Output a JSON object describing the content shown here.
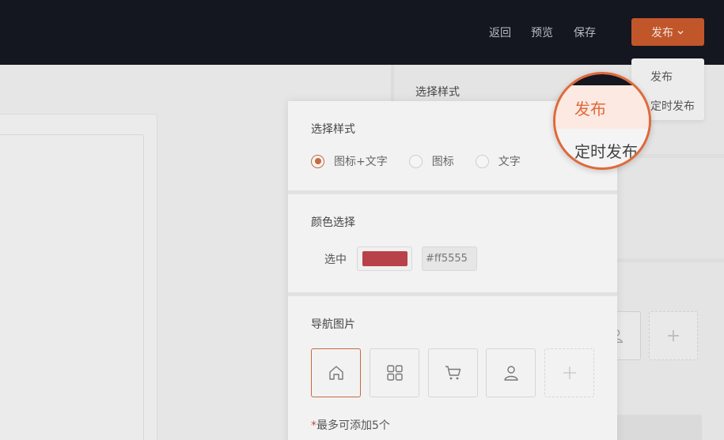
{
  "topbar": {
    "back_label": "返回",
    "preview_label": "预览",
    "save_label": "保存",
    "publish_label": "发布"
  },
  "publish_menu": {
    "items": [
      "发布",
      "定时发布"
    ]
  },
  "background_panel": {
    "title": "选择样式",
    "add_symbol": "+"
  },
  "settings": {
    "style_section": {
      "title": "选择样式",
      "options": [
        "图标+文字",
        "图标",
        "文字"
      ],
      "selected": "图标+文字"
    },
    "color_section": {
      "title": "颜色选择",
      "label": "选中",
      "swatch_color": "#b8414a",
      "value": "#ff5555"
    },
    "nav_image_section": {
      "title": "导航图片",
      "icons": [
        "home-icon",
        "grid-icon",
        "cart-icon",
        "user-icon",
        "plus-icon"
      ],
      "note_required": "*",
      "note_text": "最多可添加5个"
    }
  },
  "magnifier": {
    "items": [
      "发布",
      "定时发布"
    ]
  },
  "colors": {
    "accent": "#c1562b",
    "highlight": "#e0693a",
    "topbar": "#141620"
  }
}
